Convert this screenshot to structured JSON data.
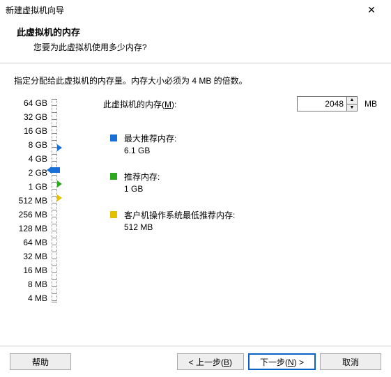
{
  "window": {
    "title": "新建虚拟机向导"
  },
  "header": {
    "title": "此虚拟机的内存",
    "sub": "您要为此虚拟机使用多少内存?"
  },
  "instruction": "指定分配给此虚拟机的内存量。内存大小必须为 4 MB 的倍数。",
  "memory": {
    "label_prefix": "此虚拟机的内存(",
    "label_key": "M",
    "label_suffix": "):",
    "value": "2048",
    "unit": "MB"
  },
  "scale": {
    "labels": [
      "64 GB",
      "32 GB",
      "16 GB",
      "8 GB",
      "4 GB",
      "2 GB",
      "1 GB",
      "512 MB",
      "256 MB",
      "128 MB",
      "64 MB",
      "32 MB",
      "16 MB",
      "8 MB",
      "4 MB"
    ],
    "thumb_index": 5
  },
  "markers": {
    "max": {
      "color": "#1a6fd6",
      "index": 3.4
    },
    "rec": {
      "color": "#2ea81f",
      "index": 6
    },
    "minRec": {
      "color": "#e2c200",
      "index": 7
    }
  },
  "recs": {
    "max": {
      "title": "最大推荐内存:",
      "value": "6.1 GB",
      "color": "#1a6fd6"
    },
    "rec": {
      "title": "推荐内存:",
      "value": "1 GB",
      "color": "#2ea81f"
    },
    "min": {
      "title": "客户机操作系统最低推荐内存:",
      "value": "512 MB",
      "color": "#e2c200"
    }
  },
  "buttons": {
    "help": "帮助",
    "back_pre": "< 上一步(",
    "back_key": "B",
    "back_post": ")",
    "next_pre": "下一步(",
    "next_key": "N",
    "next_post": ") >",
    "cancel": "取消"
  }
}
